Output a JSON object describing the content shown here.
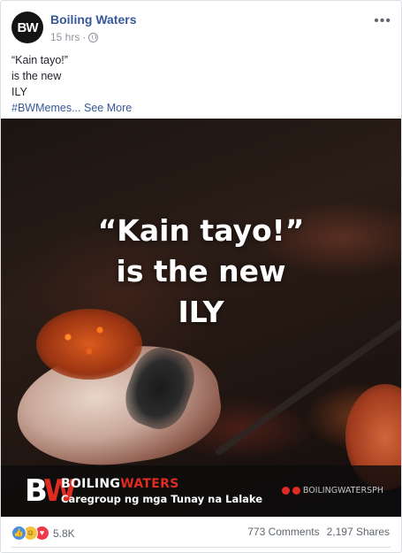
{
  "post": {
    "page_name": "Boiling Waters",
    "avatar_initials": "BW",
    "timestamp": "15 hrs",
    "more_icon": "ellipsis-icon",
    "caption_lines": [
      "“Kain tayo!”",
      "is the new",
      "ILY"
    ],
    "hashtag": "#BWMemes...",
    "see_more": "See More"
  },
  "image": {
    "meme_lines": [
      "“Kain tayo!”",
      "is the new",
      "ILY"
    ],
    "brand_logo": "BW",
    "brand_name_white": "BOILING",
    "brand_name_red": "WATERS",
    "brand_tagline": "Caregroup ng mga Tunay na Lalake",
    "brand_handle": "BOILINGWATERSPH"
  },
  "stats": {
    "reaction_icons": [
      "like-icon",
      "haha-icon",
      "love-icon"
    ],
    "reaction_count": "5.8K",
    "comments": "773 Comments",
    "shares": "2,197 Shares"
  },
  "colors": {
    "link": "#365899",
    "brand_red": "#e02b20",
    "meta_gray": "#90949c"
  }
}
